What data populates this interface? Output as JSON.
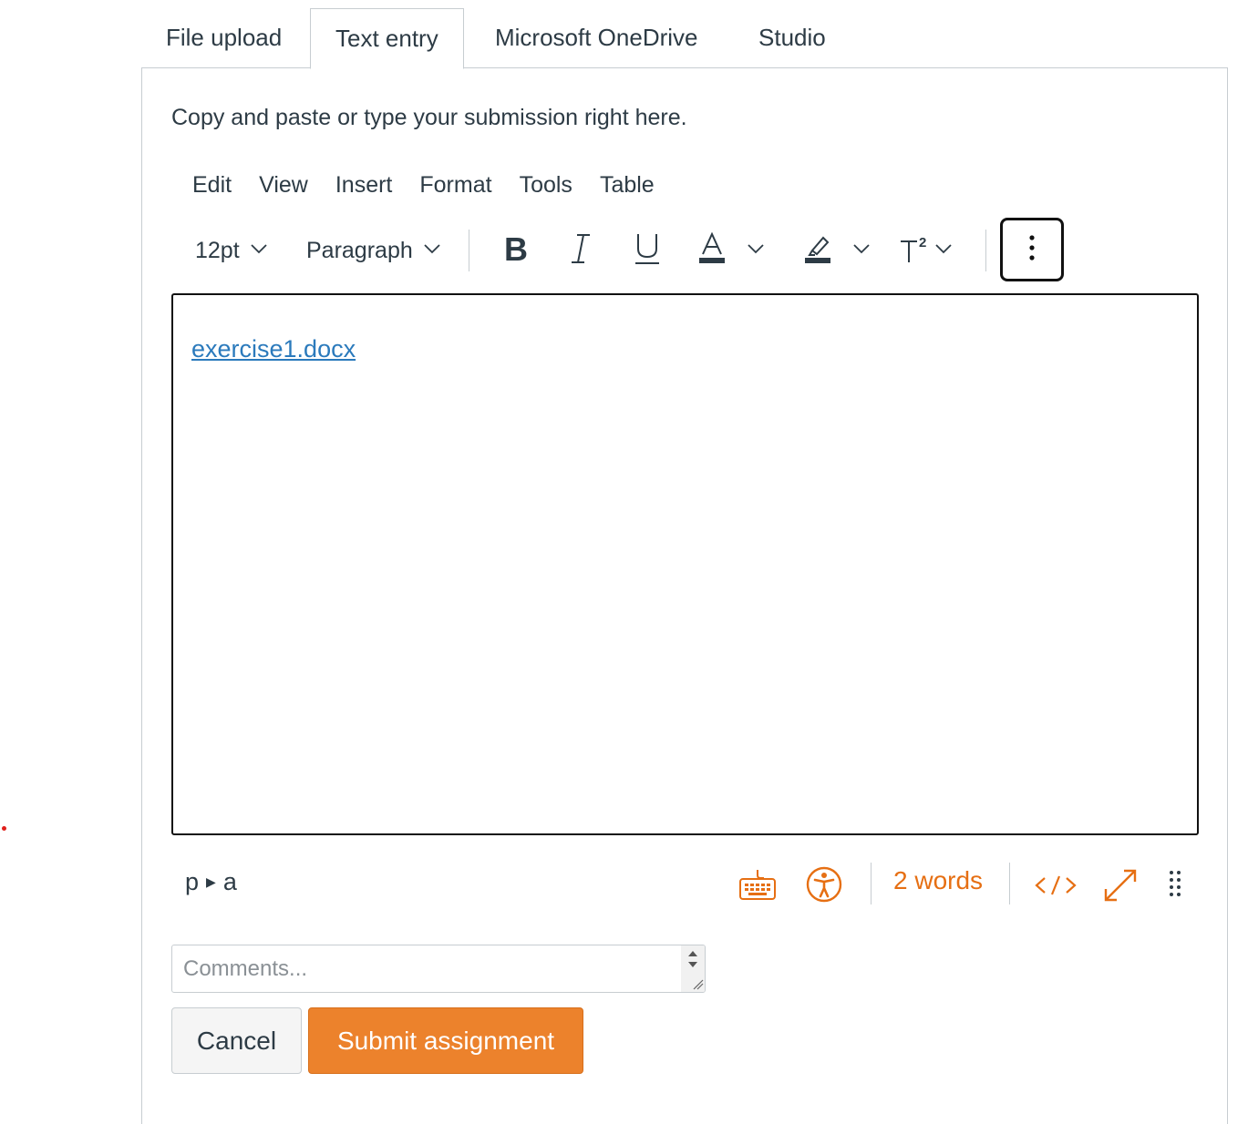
{
  "tabs": [
    {
      "label": "File upload"
    },
    {
      "label": "Text entry",
      "active": true
    },
    {
      "label": "Microsoft OneDrive"
    },
    {
      "label": "Studio"
    }
  ],
  "instructions": "Copy and paste or type your submission right here.",
  "menubar": [
    "Edit",
    "View",
    "Insert",
    "Format",
    "Tools",
    "Table"
  ],
  "toolbar": {
    "font_size": "12pt",
    "block_format": "Paragraph",
    "icons": [
      "bold-icon",
      "italic-icon",
      "underline-icon",
      "text-color-icon",
      "highlight-icon",
      "superscript-icon",
      "more-vertical-icon"
    ]
  },
  "editor": {
    "link_text": "exercise1.docx"
  },
  "statusbar": {
    "path": [
      "p",
      "a"
    ],
    "word_count": "2 words",
    "icons": [
      "keyboard-icon",
      "accessibility-icon",
      "html-code-icon",
      "fullscreen-icon",
      "resize-handle-icon"
    ],
    "accent_color": "#e66f13"
  },
  "comments": {
    "placeholder": "Comments..."
  },
  "buttons": {
    "cancel": "Cancel",
    "submit": "Submit assignment"
  },
  "colors": {
    "submit_bg": "#ec822c",
    "link": "#2b7abc"
  }
}
